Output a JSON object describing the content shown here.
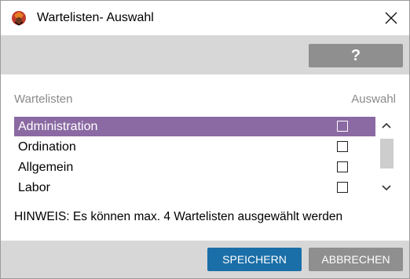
{
  "window": {
    "title": "Wartelisten- Auswahl",
    "app_icon": "app-logo-icon",
    "close_icon": "close-icon"
  },
  "toolbar": {
    "help_label": "?"
  },
  "table": {
    "col_name_header": "Wartelisten",
    "col_select_header": "Auswahl",
    "rows": [
      {
        "label": "Administration",
        "checked": false,
        "selected": true
      },
      {
        "label": "Ordination",
        "checked": false,
        "selected": false
      },
      {
        "label": "Allgemein",
        "checked": false,
        "selected": false
      },
      {
        "label": "Labor",
        "checked": false,
        "selected": false
      }
    ]
  },
  "hint": "HINWEIS: Es können max. 4 Wartelisten ausgewählt werden",
  "footer": {
    "save_label": "SPEICHERN",
    "cancel_label": "ABBRECHEN"
  },
  "colors": {
    "selection": "#8b6aa3",
    "primary_button": "#1a6fa8",
    "secondary_button": "#8f8f8f",
    "bar_background": "#d7d7d7"
  }
}
